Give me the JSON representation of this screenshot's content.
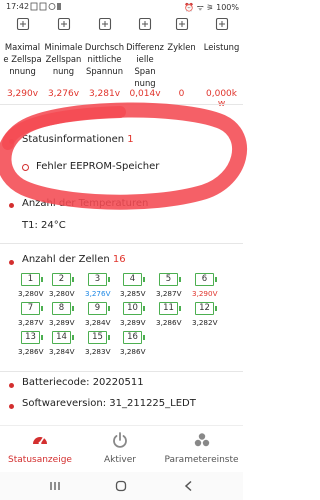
{
  "statusbar": {
    "time": "17:42",
    "right": "⏰ ᯤ ⚞ 100%"
  },
  "stats": [
    {
      "icon": "max-cell-voltage-icon",
      "label": "Maximale Zellspannung",
      "label_lines": [
        "Maximal",
        "e Zellspa",
        "nnung"
      ],
      "value": "3,290v"
    },
    {
      "icon": "min-cell-voltage-icon",
      "label": "Minimale Zellspannung",
      "label_lines": [
        "Minimale",
        "Zellspan",
        "nung"
      ],
      "value": "3,276v"
    },
    {
      "icon": "avg-voltage-icon",
      "label": "Durchschnittliche Spannung",
      "label_lines": [
        "Durchsch",
        "nittliche",
        "Spannun"
      ],
      "value": "3,281v"
    },
    {
      "icon": "diff-voltage-icon",
      "label": "Differenzielle Spannung",
      "label_lines": [
        "Differenz",
        "ielle Span",
        "nung"
      ],
      "value": "0,014v"
    },
    {
      "icon": "cycles-icon",
      "label": "Zyklen",
      "label_lines": [
        "Zyklen"
      ],
      "value": "0"
    },
    {
      "icon": "power-icon",
      "label": "Leistung",
      "label_lines": [
        "Leistung"
      ],
      "value_lines": [
        "0,000k",
        "w"
      ]
    }
  ],
  "status_info": {
    "title": "Statusinformationen",
    "count": "1",
    "error": "Fehler EEPROM-Speicher"
  },
  "temperature": {
    "title": "Anzahl der Temperaturen",
    "value": "T1:  24°C"
  },
  "cells": {
    "title": "Anzahl der Zellen",
    "count": "16",
    "items": [
      {
        "n": "1",
        "v": "3,280V",
        "c": ""
      },
      {
        "n": "2",
        "v": "3,280V",
        "c": ""
      },
      {
        "n": "3",
        "v": "3,276V",
        "c": "blue"
      },
      {
        "n": "4",
        "v": "3,285V",
        "c": ""
      },
      {
        "n": "5",
        "v": "3,287V",
        "c": ""
      },
      {
        "n": "6",
        "v": "3,290V",
        "c": "red"
      },
      {
        "n": "7",
        "v": "3,287V",
        "c": ""
      },
      {
        "n": "8",
        "v": "3,289V",
        "c": ""
      },
      {
        "n": "9",
        "v": "3,284V",
        "c": ""
      },
      {
        "n": "10",
        "v": "3,289V",
        "c": ""
      },
      {
        "n": "11",
        "v": "3,286V",
        "c": ""
      },
      {
        "n": "12",
        "v": "3,282V",
        "c": ""
      },
      {
        "n": "13",
        "v": "3,286V",
        "c": ""
      },
      {
        "n": "14",
        "v": "3,284V",
        "c": ""
      },
      {
        "n": "15",
        "v": "3,283V",
        "c": ""
      },
      {
        "n": "16",
        "v": "3,286V",
        "c": ""
      }
    ]
  },
  "battery_code": "Batteriecode:  20220511",
  "software_version": "Softwareversion:  31_211225_LEDT",
  "nav": {
    "status": "Statusanzeige",
    "active": "Aktiver",
    "params": "Parametereinste"
  },
  "colors": {
    "accent": "#d32f2f",
    "cell_green": "#4caf50",
    "value_red": "#e0342c",
    "min_blue": "#1e88e5"
  }
}
